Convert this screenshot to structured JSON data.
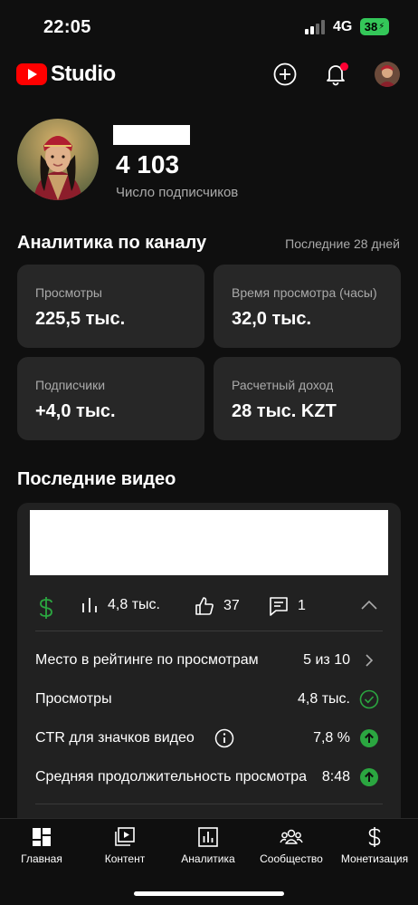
{
  "status_bar": {
    "time": "22:05",
    "network": "4G",
    "battery": "38"
  },
  "header": {
    "logo_text": "Studio",
    "icons": [
      "create-icon",
      "notifications-icon",
      "account-avatar"
    ]
  },
  "channel": {
    "subscriber_count": "4 103",
    "subscriber_label": "Число подписчиков"
  },
  "analytics": {
    "title": "Аналитика по каналу",
    "period": "Последние 28 дней",
    "cards": [
      {
        "label": "Просмотры",
        "value": "225,5 тыс."
      },
      {
        "label": "Время просмотра (часы)",
        "value": "32,0 тыс."
      },
      {
        "label": "Подписчики",
        "value": "+4,0 тыс."
      },
      {
        "label": "Расчетный доход",
        "value": "28 тыс. KZT"
      }
    ]
  },
  "recent_videos": {
    "title": "Последние видео",
    "metrics": {
      "views": "4,8 тыс.",
      "likes": "37",
      "comments": "1"
    },
    "details": [
      {
        "label": "Место в рейтинге по просмотрам",
        "value": "5 из 10",
        "icon": "chevron-right-icon"
      },
      {
        "label": "Просмотры",
        "value": "4,8 тыс.",
        "icon": "check-circle-icon"
      },
      {
        "label": "CTR для значков видео",
        "value": "7,8 %",
        "icon": "arrow-up-circle-icon"
      },
      {
        "label": "Средняя продолжительность просмотра",
        "value": "8:48",
        "icon": "arrow-up-circle-icon"
      }
    ]
  },
  "bottom_nav": [
    {
      "label": "Главная",
      "icon": "dashboard-icon"
    },
    {
      "label": "Контент",
      "icon": "content-icon"
    },
    {
      "label": "Аналитика",
      "icon": "analytics-icon"
    },
    {
      "label": "Сообщество",
      "icon": "community-icon"
    },
    {
      "label": "Монетизация",
      "icon": "monetization-icon"
    }
  ],
  "colors": {
    "background": "#0f0f0f",
    "card": "#272727",
    "accent_green": "#2ba640",
    "brand_red": "#ff0000"
  }
}
